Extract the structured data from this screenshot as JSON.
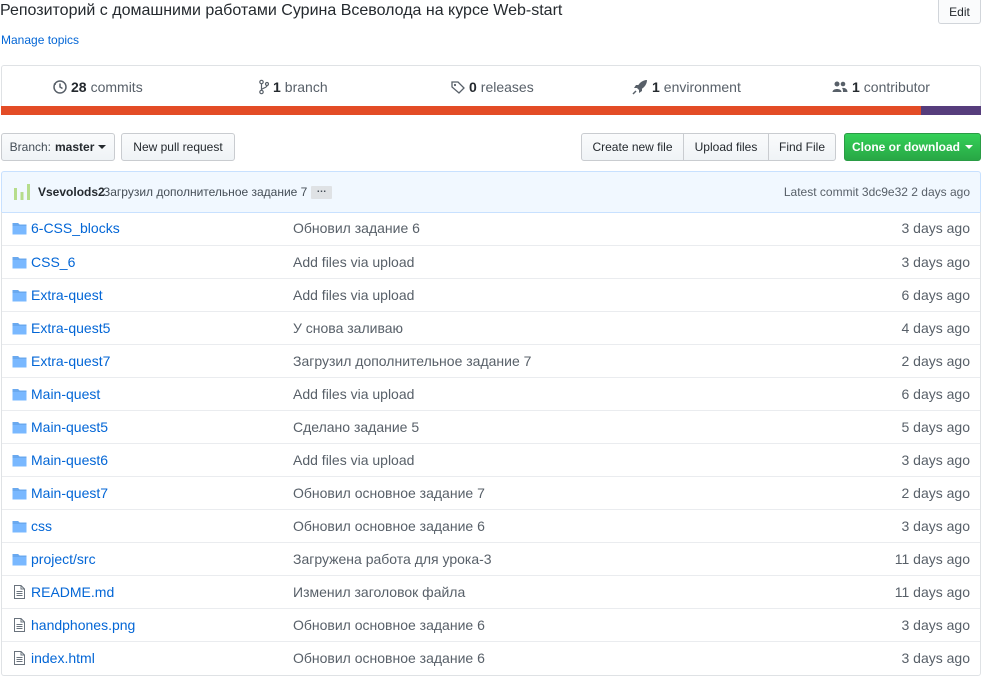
{
  "repo": {
    "description": "Репозиторий с домашними работами Сурина Всеволода на курсе Web-start",
    "edit_label": "Edit",
    "manage_topics": "Manage topics"
  },
  "summary": {
    "commits_count": "28",
    "commits_label": "commits",
    "branches_count": "1",
    "branches_label": "branch",
    "releases_count": "0",
    "releases_label": "releases",
    "environments_count": "1",
    "environments_label": "environment",
    "contributors_count": "1",
    "contributors_label": "contributor",
    "language_bar": [
      {
        "color": "#e34c26",
        "fraction": 0.939
      },
      {
        "color": "#563d7c",
        "fraction": 0.061
      }
    ]
  },
  "toolbar": {
    "branch_prefix": "Branch:",
    "branch_name": "master",
    "new_pull_request": "New pull request",
    "create_new_file": "Create new file",
    "upload_files": "Upload files",
    "find_file": "Find File",
    "clone_or_download": "Clone or download"
  },
  "latest_commit": {
    "author": "Vsevolods2",
    "message": "Загрузил дополнительное задание 7",
    "ellipsis": "…",
    "info": "Latest commit 3dc9e32 2 days ago"
  },
  "files": [
    {
      "type": "folder",
      "name": "6-CSS_blocks",
      "message": "Обновил задание 6",
      "age": "3 days ago"
    },
    {
      "type": "folder",
      "name": "CSS_6",
      "message": "Add files via upload",
      "age": "3 days ago"
    },
    {
      "type": "folder",
      "name": "Extra-quest",
      "message": "Add files via upload",
      "age": "6 days ago"
    },
    {
      "type": "folder",
      "name": "Extra-quest5",
      "message": "У снова заливаю",
      "age": "4 days ago"
    },
    {
      "type": "folder",
      "name": "Extra-quest7",
      "message": "Загрузил дополнительное задание 7",
      "age": "2 days ago"
    },
    {
      "type": "folder",
      "name": "Main-quest",
      "message": "Add files via upload",
      "age": "6 days ago"
    },
    {
      "type": "folder",
      "name": "Main-quest5",
      "message": "Сделано задание 5",
      "age": "5 days ago"
    },
    {
      "type": "folder",
      "name": "Main-quest6",
      "message": "Add files via upload",
      "age": "3 days ago"
    },
    {
      "type": "folder",
      "name": "Main-quest7",
      "message": "Обновил основное задание 7",
      "age": "2 days ago"
    },
    {
      "type": "folder",
      "name": "css",
      "message": "Обновил основное задание 6",
      "age": "3 days ago"
    },
    {
      "type": "folder",
      "name": "project/src",
      "message": "Загружена работа для урока-3",
      "age": "11 days ago"
    },
    {
      "type": "file",
      "name": "README.md",
      "message": "Изменил заголовок файла",
      "age": "11 days ago"
    },
    {
      "type": "file",
      "name": "handphones.png",
      "message": "Обновил основное задание 6",
      "age": "3 days ago"
    },
    {
      "type": "file",
      "name": "index.html",
      "message": "Обновил основное задание 6",
      "age": "3 days ago"
    }
  ]
}
